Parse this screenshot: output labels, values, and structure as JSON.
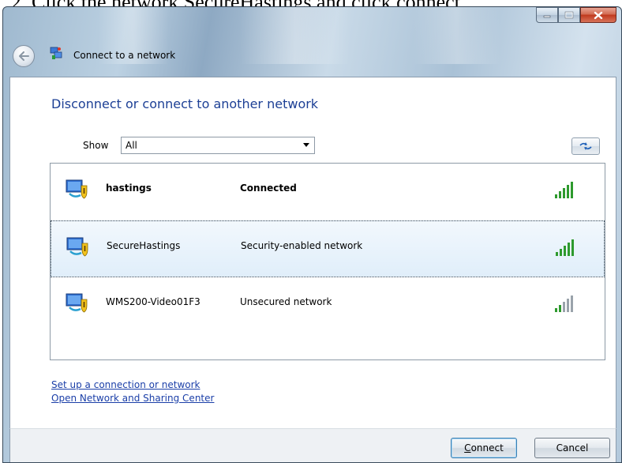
{
  "instruction": "2.   Click the network SecureHastings and click connect",
  "window": {
    "title": "Connect to a network",
    "controls": {
      "minimize": "minimize",
      "maximize": "maximize",
      "close": "close"
    }
  },
  "heading": "Disconnect or connect to another network",
  "filter": {
    "label": "Show",
    "selected": "All"
  },
  "networks": [
    {
      "name": "hastings",
      "status": "Connected",
      "bold": true,
      "signal": "full",
      "selected": false
    },
    {
      "name": "SecureHastings",
      "status": "Security-enabled network",
      "bold": false,
      "signal": "full",
      "selected": true
    },
    {
      "name": "WMS200-Video01F3",
      "status": "Unsecured network",
      "bold": false,
      "signal": "partial",
      "selected": false
    }
  ],
  "links": {
    "setup": "Set up a connection or network",
    "sharing_center": "Open Network and Sharing Center"
  },
  "buttons": {
    "connect_accel": "C",
    "connect_rest": "onnect",
    "cancel": "Cancel"
  },
  "colors": {
    "heading": "#1c3f95",
    "link": "#1b3fa8",
    "signal_green": "#2e9a2e",
    "signal_gray": "#9aa3ab",
    "selected_row": "#e0eefa"
  }
}
